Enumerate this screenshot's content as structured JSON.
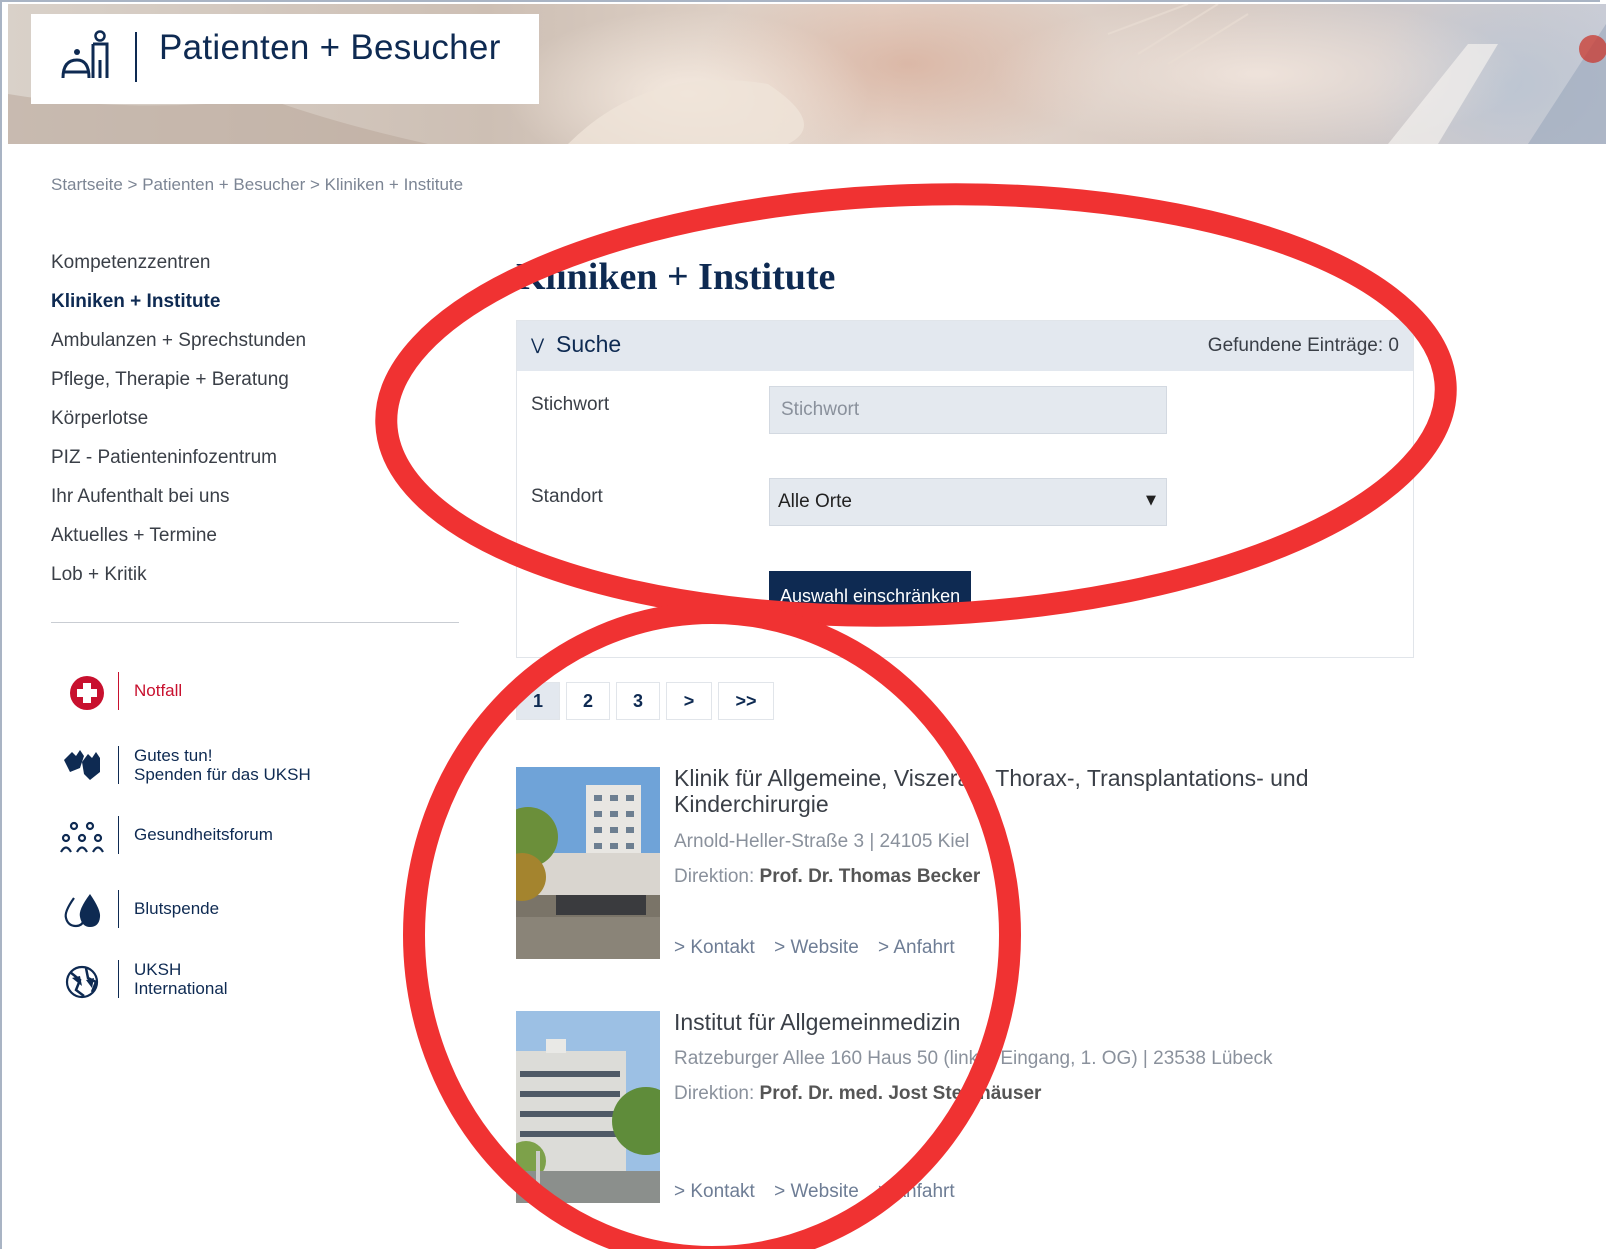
{
  "header": {
    "title": "Patienten + Besucher"
  },
  "breadcrumb": {
    "items": [
      "Startseite",
      "Patienten + Besucher",
      "Kliniken + Institute"
    ],
    "separator": ">"
  },
  "nav": {
    "items": [
      "Kompetenzzentren",
      "Kliniken + Institute",
      "Ambulanzen + Sprechstunden",
      "Pflege, Therapie + Beratung",
      "Körperlotse",
      "PIZ - Patienteninfozentrum",
      "Ihr Aufenthalt bei uns",
      "Aktuelles + Termine",
      "Lob + Kritik"
    ],
    "active_index": 1
  },
  "side_links": {
    "notfall": "Notfall",
    "spenden_line1": "Gutes tun!",
    "spenden_line2": "Spenden für das UKSH",
    "gesundheitsforum": "Gesundheitsforum",
    "blutspende": "Blutspende",
    "international_line1": "UKSH",
    "international_line2": "International"
  },
  "main": {
    "title": "Kliniken + Institute",
    "search": {
      "header_label": "Suche",
      "found_label": "Gefundene Einträge: 0",
      "keyword_label": "Stichwort",
      "keyword_placeholder": "Stichwort",
      "keyword_value": "",
      "location_label": "Standort",
      "location_value": "Alle Orte",
      "submit_label": "Auswahl einschränken"
    },
    "pagination": {
      "pages": [
        "1",
        "2",
        "3"
      ],
      "current": "1",
      "next": ">",
      "last": ">>"
    },
    "results": [
      {
        "title": "Klinik für Allgemeine, Viszeral-, Thorax-, Transplantations- und Kinderchirurgie",
        "address": "Arnold-Heller-Straße 3  |  24105 Kiel",
        "direction_label": "Direktion:",
        "director": "Prof. Dr. Thomas Becker",
        "links": [
          "> Kontakt",
          "> Website",
          "> Anfahrt"
        ]
      },
      {
        "title": "Institut für Allgemeinmedizin",
        "address": "Ratzeburger Allee 160 Haus 50 (linker Eingang, 1. OG)  |  23538 Lübeck",
        "direction_label": "Direktion:",
        "director": "Prof. Dr. med. Jost Steinhäuser",
        "links": [
          "> Kontakt",
          "> Website",
          "> Anfahrt"
        ]
      }
    ]
  },
  "colors": {
    "brand_navy": "#0e2a52",
    "emergency_red": "#c8102e",
    "annotation_red": "#f03232",
    "panel_gray": "#e3e8ef"
  }
}
